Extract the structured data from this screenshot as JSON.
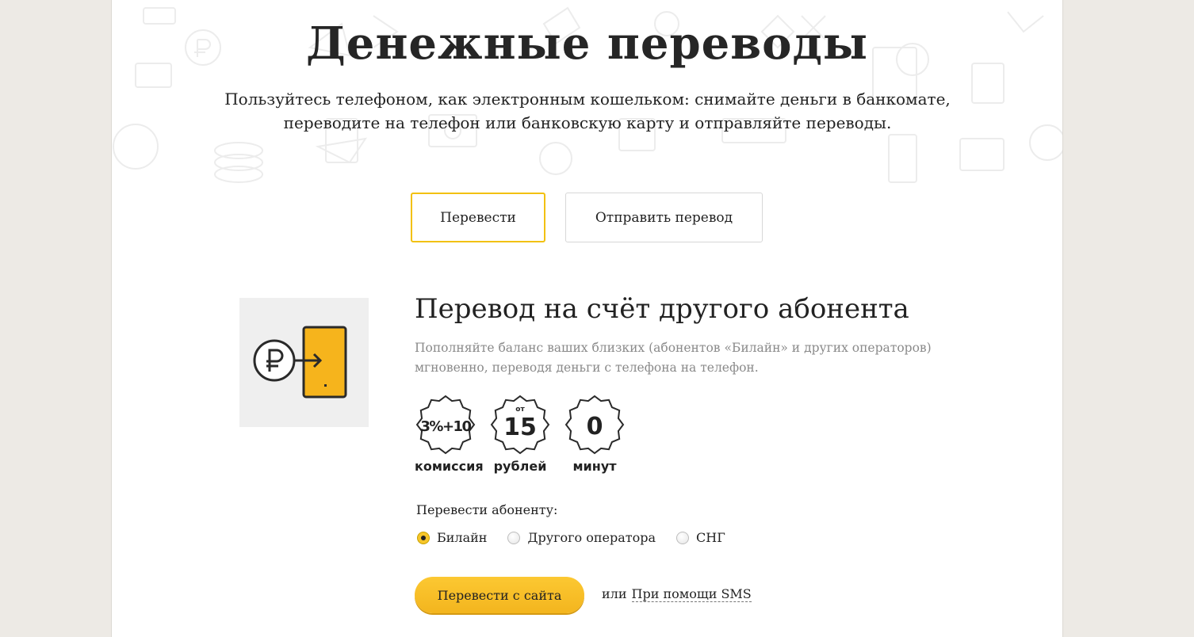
{
  "header": {
    "title": "Денежные переводы",
    "subtitle_line1": "Пользуйтесь телефоном, как электронным кошельком: снимайте деньги в банкомате,",
    "subtitle_line2": "переводите на телефон или банковскую карту и отправляйте переводы."
  },
  "tabs": [
    {
      "label": "Перевести",
      "active": true
    },
    {
      "label": "Отправить перевод",
      "active": false
    }
  ],
  "card": {
    "icon": "ruble-to-phone-icon",
    "title": "Перевод на счёт другого абонента",
    "description_line1": "Пополняйте баланс ваших близких (абонентов «Билайн» и других операторов)",
    "description_line2": "мгновенно, переводя деньги с телефона на телефон.",
    "badges": [
      {
        "value": "3%+10",
        "prefix": "",
        "label": "комиссия"
      },
      {
        "value": "15",
        "prefix": "от",
        "label": "рублей"
      },
      {
        "value": "0",
        "prefix": "",
        "label": "минут"
      }
    ]
  },
  "recipient": {
    "title": "Перевести абоненту:",
    "options": [
      {
        "label": "Билайн",
        "selected": true
      },
      {
        "label": "Другого оператора",
        "selected": false
      },
      {
        "label": "СНГ",
        "selected": false
      }
    ]
  },
  "actions": {
    "primary_label": "Перевести с сайта",
    "or_text": "или",
    "sms_link": "При помощи SMS"
  },
  "colors": {
    "accent": "#f6c62a",
    "background": "#edeae5",
    "muted_text": "#8a8a8a"
  }
}
